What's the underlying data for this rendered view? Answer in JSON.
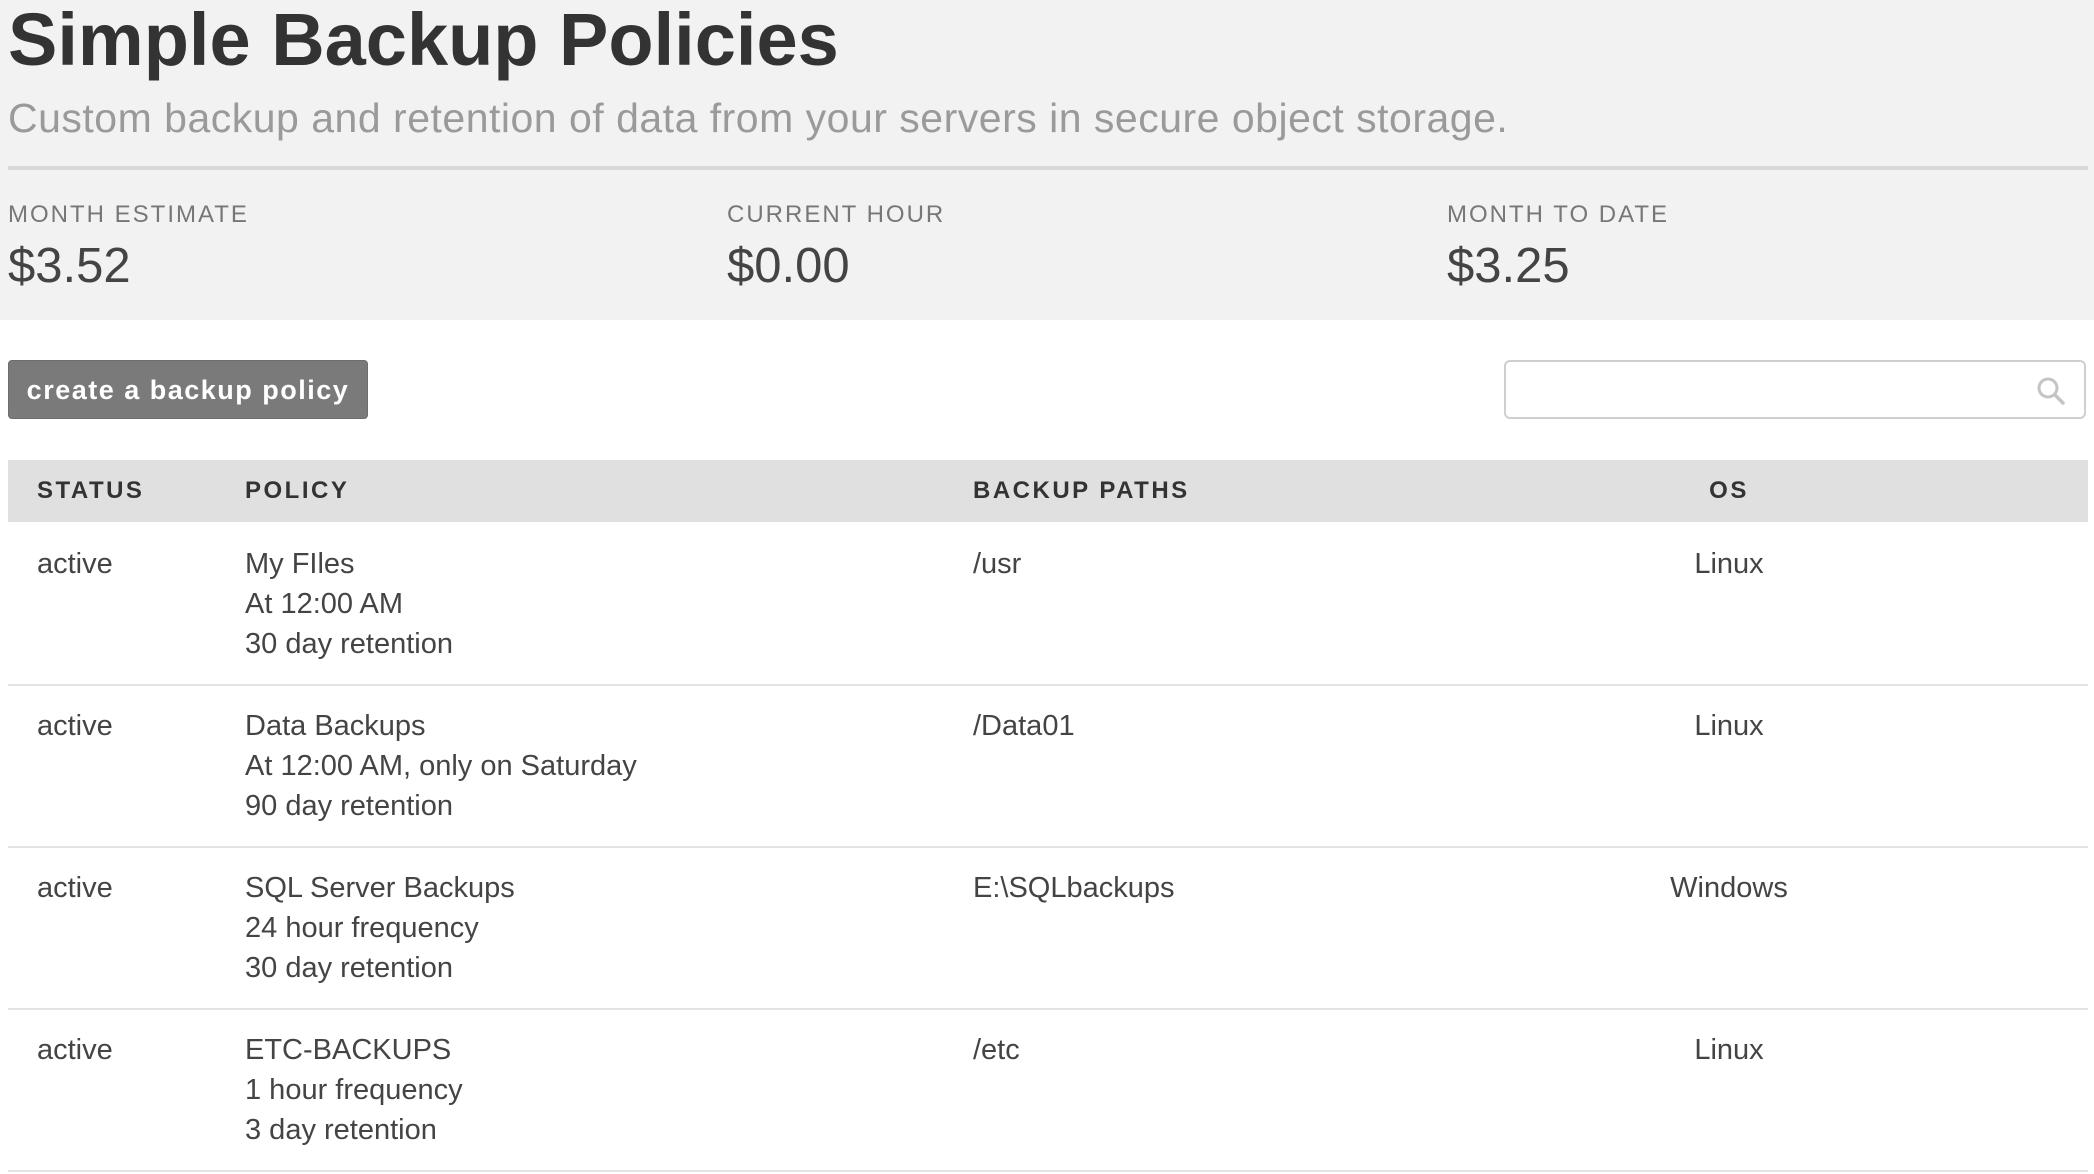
{
  "header": {
    "title": "Simple Backup Policies",
    "subtitle": "Custom backup and retention of data from your servers in secure object storage."
  },
  "stats": [
    {
      "label": "MONTH ESTIMATE",
      "value": "$3.52"
    },
    {
      "label": "CURRENT HOUR",
      "value": "$0.00"
    },
    {
      "label": "MONTH TO DATE",
      "value": "$3.25"
    }
  ],
  "toolbar": {
    "create_label": "create a backup policy",
    "search_value": "",
    "search_icon": "search-icon"
  },
  "table": {
    "columns": [
      "STATUS",
      "POLICY",
      "BACKUP PATHS",
      "OS"
    ],
    "rows": [
      {
        "status": "active",
        "policy_name": "My FIles",
        "schedule": "At 12:00 AM",
        "retention": "30 day retention",
        "path": "/usr",
        "os": "Linux"
      },
      {
        "status": "active",
        "policy_name": "Data Backups",
        "schedule": "At 12:00 AM, only on Saturday",
        "retention": "90 day retention",
        "path": "/Data01",
        "os": "Linux"
      },
      {
        "status": "active",
        "policy_name": "SQL Server Backups",
        "schedule": "24 hour frequency",
        "retention": "30 day retention",
        "path": "E:\\SQLbackups",
        "os": "Windows"
      },
      {
        "status": "active",
        "policy_name": "ETC-BACKUPS",
        "schedule": "1 hour frequency",
        "retention": "3 day retention",
        "path": "/etc",
        "os": "Linux"
      }
    ]
  }
}
